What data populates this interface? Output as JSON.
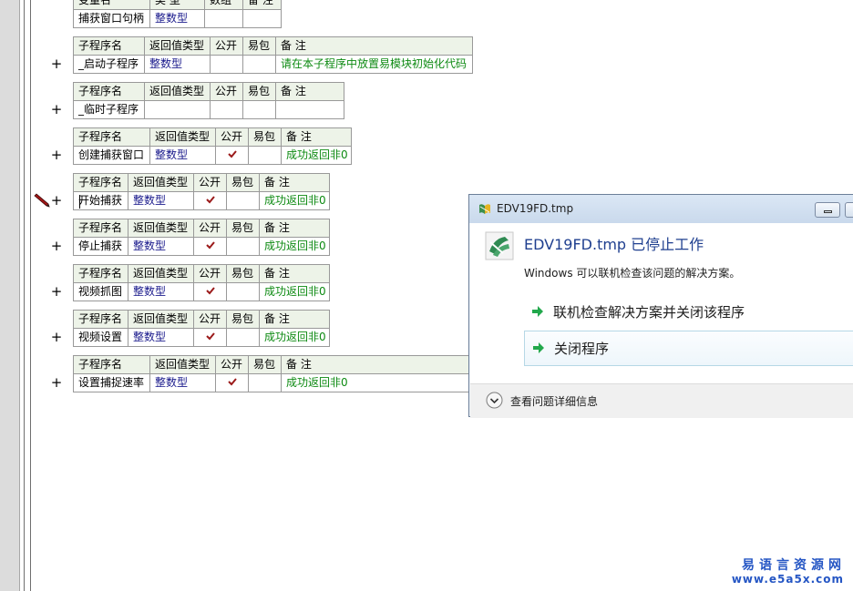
{
  "colors": {
    "header_bg": "#edf3e8",
    "type_text": "#1a1a8c",
    "note_text": "#0d8a12",
    "check_mark": "#9b1a1a",
    "dialog_heading": "#1f3f8f",
    "option_arrow": "#22a84c",
    "watermark": "#2556c4"
  },
  "var_table": {
    "headers": [
      "变量名",
      "类 型",
      "数组",
      "备 注"
    ],
    "row": {
      "name": "捕获窗口句柄",
      "type": "整数型",
      "array": "",
      "note": ""
    }
  },
  "sub_headers": [
    "子程序名",
    "返回值类型",
    "公开",
    "易包",
    "备 注"
  ],
  "subroutines": [
    {
      "name": "_启动子程序",
      "type": "整数型",
      "public": false,
      "easy": false,
      "note": "请在本子程序中放置易模块初始化代码"
    },
    {
      "name": "_临时子程序",
      "type": "",
      "public": false,
      "easy": false,
      "note": ""
    },
    {
      "name": "创建捕获窗口",
      "type": "整数型",
      "public": true,
      "easy": false,
      "note": "成功返回非0"
    },
    {
      "name": "开始捕获",
      "type": "整数型",
      "public": true,
      "easy": false,
      "note": "成功返回非0"
    },
    {
      "name": "停止捕获",
      "type": "整数型",
      "public": true,
      "easy": false,
      "note": "成功返回非0"
    },
    {
      "name": "视频抓图",
      "type": "整数型",
      "public": true,
      "easy": false,
      "note": "成功返回非0"
    },
    {
      "name": "视频设置",
      "type": "整数型",
      "public": true,
      "easy": false,
      "note": "成功返回非0"
    },
    {
      "name": "设置捕捉速率",
      "type": "整数型",
      "public": true,
      "easy": false,
      "note": "成功返回非0"
    }
  ],
  "expand_glyph": "+",
  "dialog": {
    "title": "EDV19FD.tmp",
    "heading": "EDV19FD.tmp 已停止工作",
    "subtext": "Windows 可以联机检查该问题的解决方案。",
    "options": [
      "联机检查解决方案并关闭该程序",
      "关闭程序"
    ],
    "details_label": "查看问题详细信息"
  },
  "watermark": {
    "line1": "易语言资源网",
    "line2": "www.e5a5x.com"
  }
}
